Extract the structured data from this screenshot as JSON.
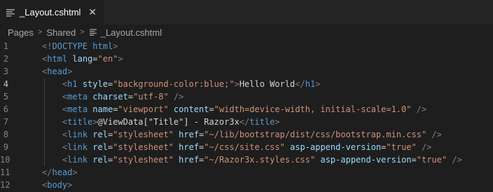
{
  "tab": {
    "filename": "_Layout.cshtml",
    "close_glyph": "✕",
    "icon": "file-code-icon"
  },
  "breadcrumb": {
    "items": [
      "Pages",
      "Shared",
      "_Layout.cshtml"
    ],
    "separator": ">"
  },
  "editor": {
    "active_line": 4,
    "lines": [
      {
        "no": "1",
        "text": "<!DOCTYPE html>"
      },
      {
        "no": "2",
        "text": "<html lang=\"en\">"
      },
      {
        "no": "3",
        "text": "<head>"
      },
      {
        "no": "4",
        "text": "    <h1 style=\"background-color:blue;\">Hello World</h1>"
      },
      {
        "no": "5",
        "text": "    <meta charset=\"utf-8\" />"
      },
      {
        "no": "6",
        "text": "    <meta name=\"viewport\" content=\"width=device-width, initial-scale=1.0\" />"
      },
      {
        "no": "7",
        "text": "    <title>@ViewData[\"Title\"] - Razor3x</title>"
      },
      {
        "no": "8",
        "text": "    <link rel=\"stylesheet\" href=\"~/lib/bootstrap/dist/css/bootstrap.min.css\" />"
      },
      {
        "no": "9",
        "text": "    <link rel=\"stylesheet\" href=\"~/css/site.css\" asp-append-version=\"true\" />"
      },
      {
        "no": "10",
        "text": "    <link rel=\"stylesheet\" href=\"~/Razor3x.styles.css\" asp-append-version=\"true\" />"
      },
      {
        "no": "11",
        "text": "</head>"
      },
      {
        "no": "12",
        "text": "<body>"
      }
    ]
  },
  "colors": {
    "background": "#1e1e1e",
    "tag": "#569cd6",
    "attribute": "#9cdcfe",
    "string": "#ce9178",
    "text": "#d4d4d4",
    "bracket": "#808080"
  }
}
